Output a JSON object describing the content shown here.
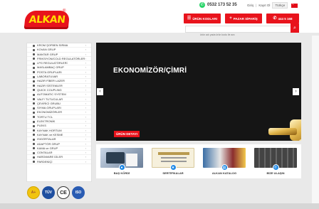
{
  "header": {
    "logo_text": "ALKAN",
    "logo_reg": "®",
    "phone": "0532 173 52 35",
    "login": "Giriş",
    "register": "Kayıt Ol",
    "language": "Türkçe",
    "btn_products": "ÜRÜN KODLARI",
    "btn_market": "PAZAR SİPARİŞ",
    "btn_phone": "444 5 168",
    "search_placeholder": "ürün adı yada ürün kodu ile ara"
  },
  "sidebar": {
    "items": [
      "KROM ŞOFBEN SIRMA",
      "KOVAN GRUP",
      "MANTAR GRUP",
      "FRIKSIYON/COLD REGULATÖRLER",
      "LPG REGULATÖRLERİ",
      "MASLAMBAÇ GRUP",
      "POSTA GRUPLARI",
      "LABORATUVAR",
      "HAZIR FİBER LAZER",
      "HAZIR SİSTEMLER",
      "QUICK COUPLING",
      "AUTOMATIC SYSTEM",
      "VALF/ TUTUCULAR",
      "ÇEVİRİCİ GRUBU",
      "SIYMA GRUPLARI",
      "EKONOMİZÖRLER",
      "TORTU TCL",
      "ELEKTRONİK",
      "PLEKS",
      "KAYNAK HORTUM",
      "KAYNAK ve KESME",
      "ISIGÖRTALAR",
      "ADAPTÖR GRUP",
      "KAMA ve GRUP",
      "CONTALAR",
      "HARDWARE DİLER",
      "PARDENİÇİ"
    ]
  },
  "certs": [
    "A+",
    "TÜV",
    "CE",
    "ISO"
  ],
  "slider": {
    "title": "EKONOMİZÖR/ÇİMRİ",
    "button": "ÜRÜN DETAYI",
    "prev": "‹",
    "next": "›"
  },
  "features": [
    {
      "label": "BAŞ KÖRDİ",
      "icon": "person-icon"
    },
    {
      "label": "SERTİFİKALAR",
      "icon": "certificate-icon"
    },
    {
      "label": "ALKAN KATALOG",
      "icon": "book-icon"
    },
    {
      "label": "BİZE ULAŞIN",
      "icon": "phone-icon"
    }
  ],
  "colors": {
    "accent": "#e8131c",
    "blue": "#1e88e5"
  }
}
